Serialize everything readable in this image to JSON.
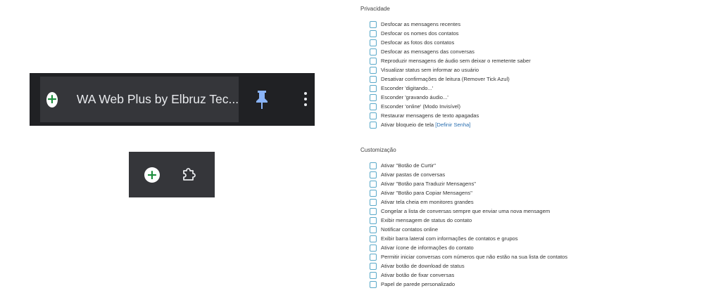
{
  "toolbar": {
    "extension_name": "WA Web Plus by Elbruz Tec..."
  },
  "privacy": {
    "title": "Privacidade",
    "options": [
      {
        "label": "Desfocar as mensagens recentes"
      },
      {
        "label": "Desfocar os nomes dos contatos"
      },
      {
        "label": "Desfocar as fotos dos contatos"
      },
      {
        "label": "Desfocar as mensagens das conversas"
      },
      {
        "label": "Reproduzir mensagens de áudio sem deixar o remetente saber"
      },
      {
        "label": "Visualizar status sem informar ao usuário"
      },
      {
        "label": "Desativar confirmações de leitura (Remover Tick Azul)"
      },
      {
        "label": "Esconder 'digitando...'"
      },
      {
        "label": "Esconder 'gravando áudio...'"
      },
      {
        "label": "Esconder 'online' (Modo Invisível)"
      },
      {
        "label": "Restaurar mensagens de texto apagadas"
      },
      {
        "label": "Ativar bloqueio de tela",
        "link": "[Definir Senha]"
      }
    ]
  },
  "customization": {
    "title": "Customização",
    "options": [
      {
        "label": "Ativar \"Botão de Curtir\""
      },
      {
        "label": "Ativar pastas de conversas"
      },
      {
        "label": "Ativar \"Botão para Traduzir Mensagens\""
      },
      {
        "label": "Ativar \"Botão para Copiar Mensagens\""
      },
      {
        "label": "Ativar tela cheia em monitores grandes"
      },
      {
        "label": "Congelar a lista de conversas sempre que enviar uma nova mensagem"
      },
      {
        "label": "Exibir mensagem de status do contato"
      },
      {
        "label": "Notificar contatos online"
      },
      {
        "label": "Exibir barra lateral com informações de contatos e grupos"
      },
      {
        "label": "Ativar ícone de informações do contato"
      },
      {
        "label": "Permitir iniciar conversas com números que não estão na sua lista de contatos"
      },
      {
        "label": "Ativar botão de download de status"
      },
      {
        "label": "Ativar botão de fixar conversas"
      },
      {
        "label": "Papel de parede personalizado"
      }
    ]
  },
  "icons": {
    "extension": "plus-circle-icon",
    "pin": "pin-icon",
    "menu": "more-vertical-icon",
    "extensions": "puzzle-icon"
  },
  "colors": {
    "toolbar_bg": "#202124",
    "item_bg": "#35363a",
    "plus_green": "#1e8e3e",
    "pin_blue": "#8ab4f8",
    "checkbox_border": "#5aa9c9",
    "link": "#2a6fb0"
  }
}
